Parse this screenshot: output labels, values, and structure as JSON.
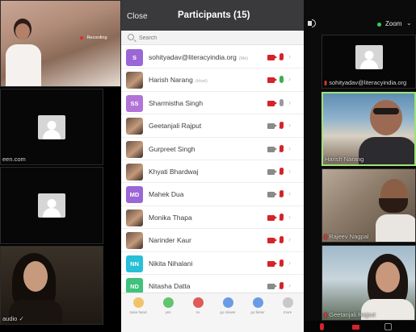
{
  "tiles": [
    {
      "name": "",
      "badge": "Recording",
      "type": "video"
    },
    {
      "name": "een.com",
      "type": "avatar"
    },
    {
      "name": "",
      "type": "avatar"
    },
    {
      "name": "audio",
      "type": "video"
    },
    {
      "name": "sohityadav@literacyindia.org",
      "type": "avatar"
    },
    {
      "name": "Harish Narang",
      "type": "video"
    },
    {
      "name": "Rajeev Nagpal",
      "type": "video"
    },
    {
      "name": "Geetanjali Rajput",
      "type": "video"
    }
  ],
  "panel": {
    "close_label": "Close",
    "title": "Participants (15)",
    "search_placeholder": "Search",
    "participants": [
      {
        "initials": "S",
        "name": "sohityadav@literacyindia.org",
        "tag": "(Me)",
        "avatar_color": "#9b66d6",
        "photo": false,
        "cam": "off",
        "mic": "muted"
      },
      {
        "initials": "",
        "name": "Harish Narang",
        "tag": "(Host)",
        "avatar_color": "#7a5a48",
        "photo": true,
        "cam": "off",
        "mic": "live"
      },
      {
        "initials": "SS",
        "name": "Sharmistha Singh",
        "tag": "",
        "avatar_color": "#b273d6",
        "photo": false,
        "cam": "off",
        "mic": "idle"
      },
      {
        "initials": "",
        "name": "Geetanjali Rajput",
        "tag": "",
        "avatar_color": "#7a5a48",
        "photo": true,
        "cam": "on",
        "mic": "muted"
      },
      {
        "initials": "",
        "name": "Gurpreet Singh",
        "tag": "",
        "avatar_color": "#5a4a3a",
        "photo": true,
        "cam": "on",
        "mic": "muted"
      },
      {
        "initials": "",
        "name": "Khyati Bhardwaj",
        "tag": "",
        "avatar_color": "#5a4a3a",
        "photo": true,
        "cam": "on",
        "mic": "muted"
      },
      {
        "initials": "MD",
        "name": "Mahek Dua",
        "tag": "",
        "avatar_color": "#9b66d6",
        "photo": false,
        "cam": "on",
        "mic": "muted"
      },
      {
        "initials": "",
        "name": "Monika Thapa",
        "tag": "",
        "avatar_color": "#5a4a3a",
        "photo": true,
        "cam": "off",
        "mic": "muted"
      },
      {
        "initials": "",
        "name": "Narinder Kaur",
        "tag": "",
        "avatar_color": "#5a4a3a",
        "photo": true,
        "cam": "off",
        "mic": "muted"
      },
      {
        "initials": "NN",
        "name": "Nikita Nihalani",
        "tag": "",
        "avatar_color": "#27c0d6",
        "photo": false,
        "cam": "off",
        "mic": "muted"
      },
      {
        "initials": "ND",
        "name": "Nitasha Datta",
        "tag": "",
        "avatar_color": "#3fc27a",
        "photo": false,
        "cam": "on",
        "mic": "muted"
      }
    ],
    "bottom_buttons": [
      {
        "label": "raise hand",
        "color": "#f2c26b"
      },
      {
        "label": "yes",
        "color": "#61c46e"
      },
      {
        "label": "no",
        "color": "#e05a5a"
      },
      {
        "label": "go slower",
        "color": "#6b9be6"
      },
      {
        "label": "go faster",
        "color": "#6b9be6"
      },
      {
        "label": "more",
        "color": "#c8c8c8"
      }
    ]
  },
  "right_toolbar": {
    "zoom_label": "Zoom",
    "zoom_chevron": "⌄",
    "audio_icon": "speaker-icon"
  },
  "colors": {
    "red": "#d4242a",
    "green": "#37b24d",
    "header": "#3a3a3c"
  }
}
